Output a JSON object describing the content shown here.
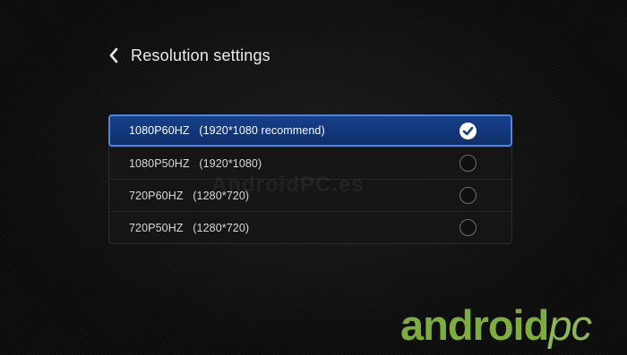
{
  "header": {
    "back_icon": "chevron-left-icon",
    "title": "Resolution settings"
  },
  "options": [
    {
      "mode": "1080P60HZ",
      "detail": "(1920*1080 recommend)",
      "selected": true
    },
    {
      "mode": "1080P50HZ",
      "detail": "(1920*1080)",
      "selected": false
    },
    {
      "mode": "720P60HZ",
      "detail": "(1280*720)",
      "selected": false
    },
    {
      "mode": "720P50HZ",
      "detail": "(1280*720)",
      "selected": false
    }
  ],
  "watermark": {
    "center_text": "AndroidPC.es",
    "logo_part1": "android",
    "logo_part2": "pc"
  },
  "colors": {
    "selected_bg": "#17408a",
    "selected_border": "#4a86e8",
    "logo_green": "#7dae3a"
  }
}
